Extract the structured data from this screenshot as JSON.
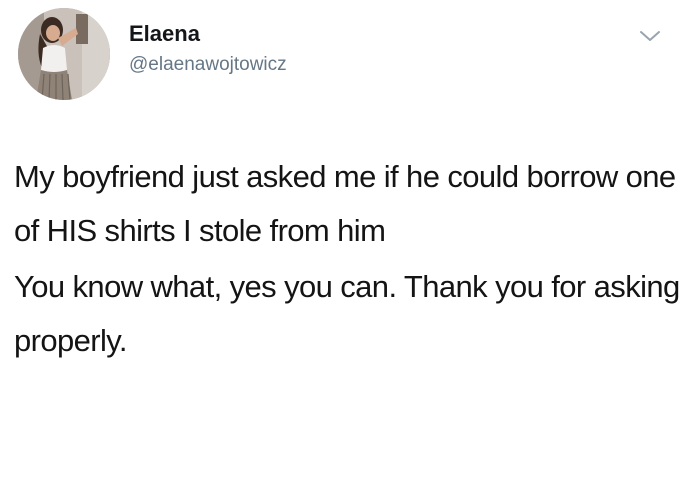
{
  "user": {
    "display_name": "Elaena",
    "handle": "@elaenawojtowicz"
  },
  "tweet": {
    "paragraphs": [
      "My boyfriend just asked me if he could borrow one of HIS shirts I stole from him",
      "You know what, yes you can. Thank you for asking properly."
    ]
  },
  "icons": {
    "menu_caret": "chevron-down-icon"
  },
  "colors": {
    "name": "#14171a",
    "handle": "#657786",
    "text": "#141414",
    "caret": "#9aa4ad"
  }
}
